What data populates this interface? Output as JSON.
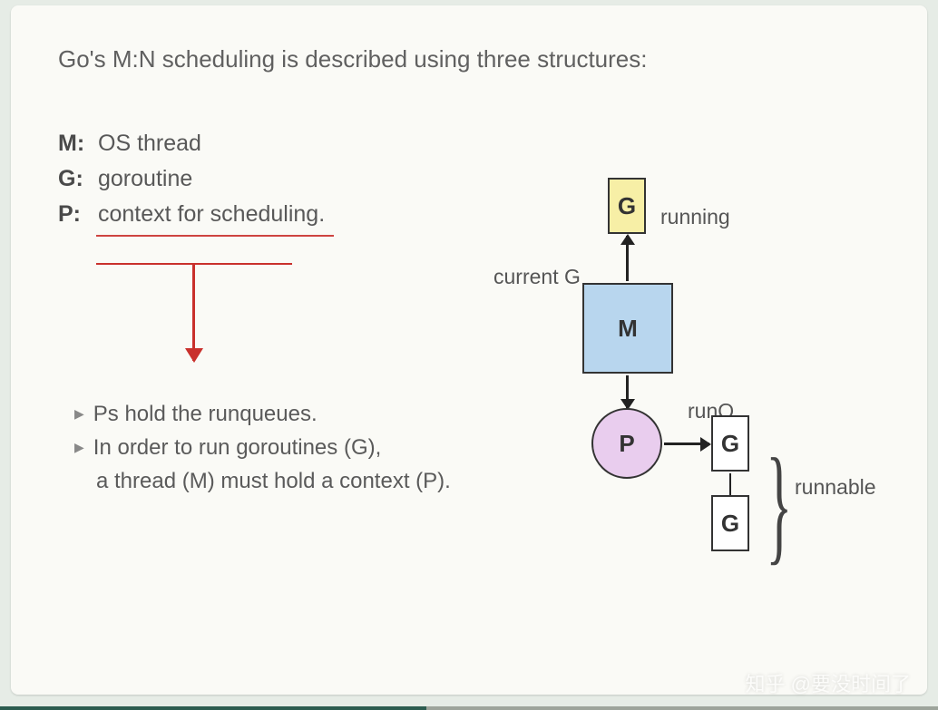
{
  "title": "Go's M:N scheduling is described using three structures:",
  "defs": {
    "m_key": "M:",
    "m_val": "OS thread",
    "g_key": "G:",
    "g_val": "goroutine",
    "p_key": "P:",
    "p_val": "context for scheduling."
  },
  "bullets": {
    "b1": "Ps hold the runqueues.",
    "b2": "In order to run goroutines (G),",
    "b2b": "a thread (M) must hold a context (P)."
  },
  "diagram": {
    "g": "G",
    "m": "M",
    "p": "P",
    "running": "running",
    "currentG": "current G",
    "runQ": "runQ",
    "runnable": "runnable"
  },
  "watermark": "知乎 @要没时间了"
}
